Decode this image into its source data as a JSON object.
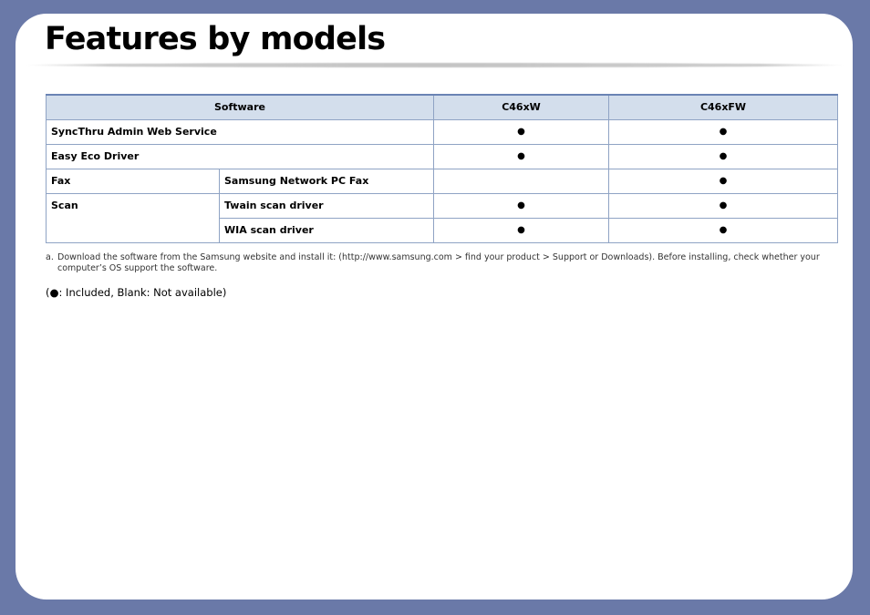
{
  "page": {
    "title": "Features by models"
  },
  "table": {
    "headers": {
      "software": "Software",
      "model_a": "C46xW",
      "model_b": "C46xFW"
    },
    "rows": [
      {
        "label": "SyncThru Admin Web Service",
        "a": "●",
        "b": "●"
      },
      {
        "label": "Easy Eco Driver",
        "a": "●",
        "b": "●"
      },
      {
        "group": "Fax",
        "label": "Samsung Network PC Fax",
        "a": "",
        "b": "●"
      },
      {
        "group": "Scan",
        "label": "Twain scan driver",
        "a": "●",
        "b": "●"
      },
      {
        "label": "WIA scan driver",
        "a": "●",
        "b": "●"
      }
    ]
  },
  "footnote": {
    "marker": "a.",
    "text": "Download the software from the Samsung website and install it: (http://www.samsung.com > find your product > Support or Downloads). Before installing, check whether your computer’s OS support the software."
  },
  "legend": {
    "text": "(●: Included, Blank: Not available)"
  },
  "colors": {
    "background": "#6a79a8",
    "header_fill": "#d3deec",
    "table_border": "#8fa3c4"
  }
}
